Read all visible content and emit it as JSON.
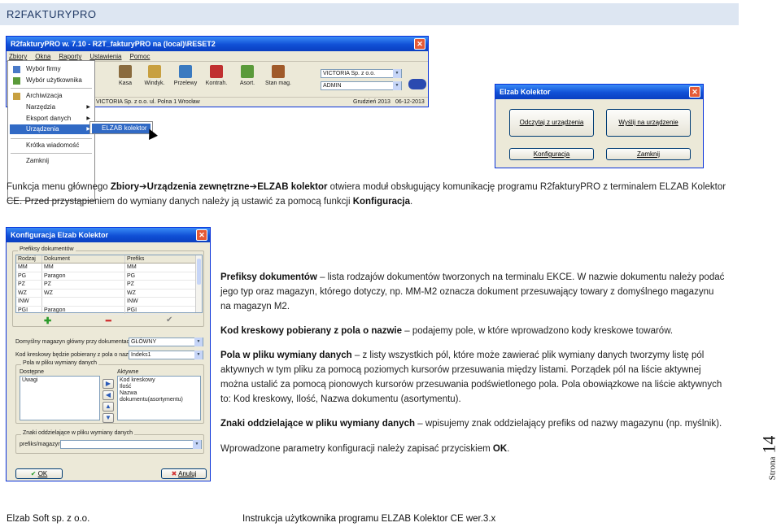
{
  "header": {
    "title": "R2FAKTURYPRO"
  },
  "shot1": {
    "title": "R2fakturyPRO w. 7.10 - R2T_fakturyPRO na (local)\\RESET2",
    "menubar": [
      "Zbiory",
      "Okna",
      "Raporty",
      "Ustawienia",
      "Pomoc"
    ],
    "menu_items": [
      "Wybór firmy",
      "Wybór użytkownika",
      "Archiwizacja",
      "Narzędzia",
      "Eksport danych",
      "Urządzenia zewnętrzne",
      "Krótka wiadomość",
      "Zamknij"
    ],
    "submenu_item": "ELZAB kolektor",
    "tools": [
      "Kasa",
      "Windyk.",
      "Przelewy",
      "Kontrah.",
      "Asort.",
      "Stan mag."
    ],
    "company_combo": "VICTORIA Sp. z o.o.",
    "user_combo": "ADMIN",
    "status_left": "VICTORIA Sp. z o.o. ul. Polna 1 Wrocław",
    "status_right": "Grudzień 2013",
    "status_date": "06-12-2013"
  },
  "shot2": {
    "title": "Elzab Kolektor",
    "btn_read": "Odczytaj z urządzenia",
    "btn_send": "Wyślij na urządzenie",
    "btn_config": "Konfiguracja",
    "btn_close": "Zamknij"
  },
  "intro": {
    "t1": "Funkcja menu głównego ",
    "b1": "Zbiory",
    "b2": "Urządzenia zewnętrzne",
    "b3": "ELZAB kolektor",
    "t2": " otwiera moduł obsługujący komunikację programu R2fakturyPRO z terminalem ELZAB Kolektor",
    "t3": "CE. Przed przystąpieniem do wymiany danych należy ją ustawić za pomocą funkcji ",
    "b4": "Konfiguracja",
    "t4": "."
  },
  "shot3": {
    "title": "Konfiguracja Elzab Kolektor",
    "group_prefixes": "Prefiksy dokumentów",
    "columns": [
      "Rodzaj",
      "Dokument",
      "Prefiks"
    ],
    "rows": [
      [
        "MM",
        "MM",
        "MM"
      ],
      [
        "PG",
        "Paragon",
        "PG"
      ],
      [
        "PZ",
        "PZ",
        "PZ"
      ],
      [
        "WZ",
        "WZ",
        "WZ"
      ],
      [
        "INW",
        "",
        "INW"
      ],
      [
        "PGI",
        "Paragon",
        "PGI"
      ]
    ],
    "default_store_label": "Domyślny magazyn główny przy dokumentach MM",
    "default_store_value": "GŁÓWNY",
    "barcode_label": "Kod kreskowy będzie pobierany z pola o nazwie",
    "barcode_value": "Indeks1",
    "fields_group": "Pola w pliku wymiany danych",
    "available_label": "Dostępne",
    "available_items": [
      "Uwagi"
    ],
    "active_label": "Aktywne",
    "active_items": [
      "Kod kreskowy",
      "Ilość",
      "Nazwa dokumentu(asortymentu)"
    ],
    "separator_group": "Znaki oddzielające w pliku wymiany danych",
    "separator_label": "prefiks/magazyn",
    "ok_label": "OK",
    "cancel_label": "Anuluj"
  },
  "desc": {
    "p1_b": "Prefiksy dokumentów",
    "p1_t1": " – lista rodzajów dokumentów tworzonych na terminalu EKCE. W nazwie dokumentu należy podać",
    "p1_t2": "jego typ oraz magazyn, którego dotyczy, np. MM-M2 oznacza dokument przesuwający towary z domyślnego magazynu",
    "p1_t3": "na magazyn M2.",
    "p2_b": "Kod kreskowy pobierany z pola o nazwie",
    "p2_t": " – podajemy pole, w które wprowadzono kody kreskowe towarów.",
    "p3_b": "Pola w pliku wymiany danych",
    "p3_t1": " – z listy wszystkich pól, które może zawierać plik wymiany danych tworzymy listę pól",
    "p3_t2": "aktywnych w tym pliku za pomocą poziomych kursorów przesuwania między listami. Porządek pól na liście aktywnej",
    "p3_t3": "można ustalić za pomocą pionowych kursorów przesuwania podświetlonego pola. Pola obowiązkowe na liście aktywnych",
    "p3_t4": "to: Kod kreskowy, Ilość, Nazwa dokumentu (asortymentu).",
    "p4_b": "Znaki oddzielające w pliku wymiany danych",
    "p4_t": " – wpisujemy znak oddzielający prefiks od nazwy magazynu (np. myślnik).",
    "p5_t": "Wprowadzone parametry konfiguracji należy zapisać przyciskiem ",
    "p5_b": "OK",
    "p5_end": "."
  },
  "side": {
    "word": "Strona",
    "number": "14"
  },
  "footer": {
    "left": "Elzab Soft sp. z o.o.",
    "center": "Instrukcja użytkownika programu ELZAB Kolektor CE wer.3.x"
  }
}
